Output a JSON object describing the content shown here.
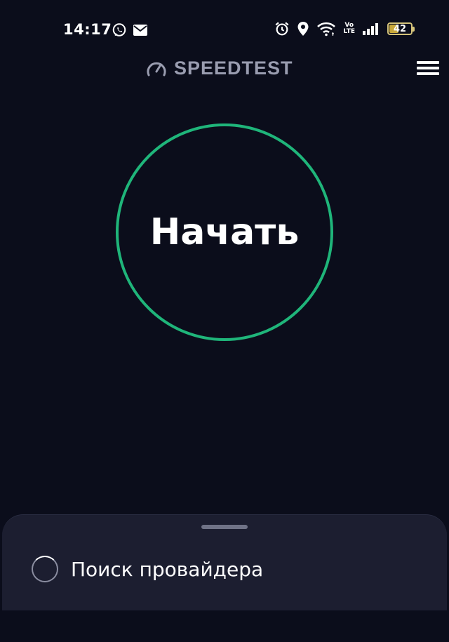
{
  "status_bar": {
    "time": "14:17",
    "left_icons": [
      "whatsapp-icon",
      "mail-icon"
    ],
    "right_icons": [
      "alarm-icon",
      "location-icon",
      "wifi-icon",
      "volte-icon",
      "signal-icon",
      "battery-icon"
    ],
    "volte_top": "Vo",
    "volte_bottom": "LTE",
    "battery_level": "42"
  },
  "header": {
    "brand": "SPEEDTEST",
    "brand_icon": "speedometer-icon",
    "menu_icon": "hamburger-menu-icon"
  },
  "main": {
    "start_label": "Начать",
    "accent_color": "#1fb57a"
  },
  "bottom_sheet": {
    "provider_status": "Поиск провайдера"
  },
  "colors": {
    "background": "#0b0d1b",
    "sheet": "#1c1e30",
    "brand_text": "#9a9db0"
  }
}
